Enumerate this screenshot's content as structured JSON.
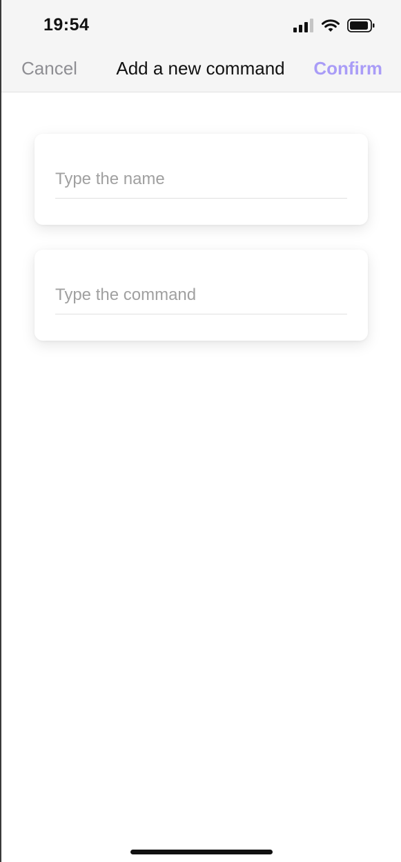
{
  "status_bar": {
    "time": "19:54",
    "icons": [
      "cellular-signal-icon",
      "wifi-icon",
      "battery-icon"
    ]
  },
  "nav_bar": {
    "cancel_label": "Cancel",
    "title": "Add a new command",
    "confirm_label": "Confirm"
  },
  "form": {
    "name_field": {
      "placeholder": "Type the name",
      "value": ""
    },
    "command_field": {
      "placeholder": "Type the command",
      "value": ""
    }
  },
  "colors": {
    "accent": "#a99cf7",
    "cancel": "#8e8e93",
    "header_background": "#f5f5f5"
  }
}
